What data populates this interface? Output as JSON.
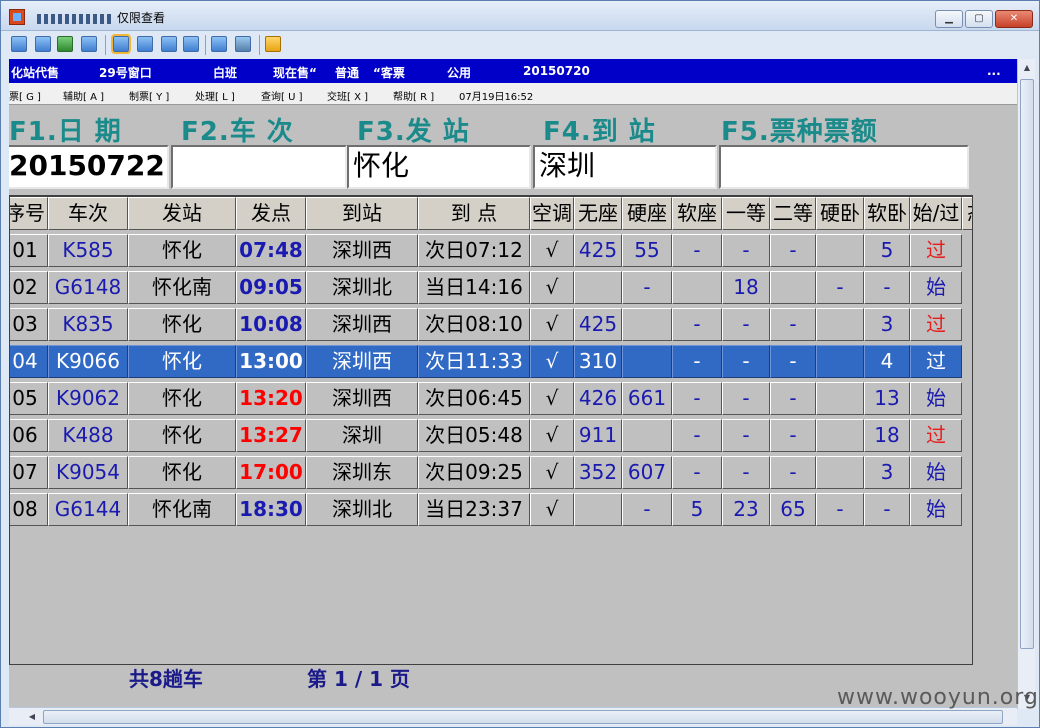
{
  "window": {
    "title": "仅限查看"
  },
  "status": {
    "station": "化站代售",
    "window_no": "29号窗口",
    "shift": "白班",
    "selling_label": "现在售“",
    "selling_type": "普通",
    "ticket_kind": "“客票",
    "purpose": "公用",
    "date": "20150720",
    "more": "..."
  },
  "menu": [
    "票[ G ]",
    "辅助[ A ]",
    "制票[ Y ]",
    "处理[ L ]",
    "查询[ U ]",
    "交班[ X ]",
    "帮助[ R ]",
    "07月19日16:52"
  ],
  "form": {
    "f1_label": "F1.日 期",
    "f2_label": "F2.车 次",
    "f3_label": "F3.发 站",
    "f4_label": "F4.到 站",
    "f5_label": "F5.票种票额",
    "f1_value": "20150722",
    "f2_value": "",
    "f3_value": "怀化",
    "f4_value": "深圳",
    "f5_value": ""
  },
  "table": {
    "headers": [
      "序号",
      "车次",
      "发站",
      "发点",
      "到站",
      "到 点",
      "空调",
      "无座",
      "硬座",
      "软座",
      "一等",
      "二等",
      "硬卧",
      "软卧",
      "始/过",
      "态"
    ],
    "rows": [
      {
        "no": "01",
        "train": "K585",
        "from": "怀化",
        "dep": "07:48",
        "dep_red": false,
        "to": "深圳西",
        "arr": "次日07:12",
        "ac": "√",
        "wz": "425",
        "yz": "55",
        "rz": "-",
        "yd": "-",
        "ed": "-",
        "yw": "",
        "rw": "5",
        "sg": "过"
      },
      {
        "no": "02",
        "train": "G6148",
        "from": "怀化南",
        "dep": "09:05",
        "dep_red": false,
        "to": "深圳北",
        "arr": "当日14:16",
        "ac": "√",
        "wz": "",
        "yz": "-",
        "rz": "",
        "yd": "18",
        "ed": "",
        "yw": "-",
        "rw": "-",
        "sg": "始"
      },
      {
        "no": "03",
        "train": "K835",
        "from": "怀化",
        "dep": "10:08",
        "dep_red": false,
        "to": "深圳西",
        "arr": "次日08:10",
        "ac": "√",
        "wz": "425",
        "yz": "",
        "rz": "-",
        "yd": "-",
        "ed": "-",
        "yw": "",
        "rw": "3",
        "sg": "过"
      },
      {
        "no": "04",
        "train": "K9066",
        "from": "怀化",
        "dep": "13:00",
        "dep_red": false,
        "to": "深圳西",
        "arr": "次日11:33",
        "ac": "√",
        "wz": "310",
        "yz": "",
        "rz": "-",
        "yd": "-",
        "ed": "-",
        "yw": "",
        "rw": "4",
        "sg": "过",
        "selected": true
      },
      {
        "no": "05",
        "train": "K9062",
        "from": "怀化",
        "dep": "13:20",
        "dep_red": true,
        "to": "深圳西",
        "arr": "次日06:45",
        "ac": "√",
        "wz": "426",
        "yz": "661",
        "rz": "-",
        "yd": "-",
        "ed": "-",
        "yw": "",
        "rw": "13",
        "sg": "始"
      },
      {
        "no": "06",
        "train": "K488",
        "from": "怀化",
        "dep": "13:27",
        "dep_red": true,
        "to": "深圳",
        "arr": "次日05:48",
        "ac": "√",
        "wz": "911",
        "yz": "",
        "rz": "-",
        "yd": "-",
        "ed": "-",
        "yw": "",
        "rw": "18",
        "sg": "过"
      },
      {
        "no": "07",
        "train": "K9054",
        "from": "怀化",
        "dep": "17:00",
        "dep_red": true,
        "to": "深圳东",
        "arr": "次日09:25",
        "ac": "√",
        "wz": "352",
        "yz": "607",
        "rz": "-",
        "yd": "-",
        "ed": "-",
        "yw": "",
        "rw": "3",
        "sg": "始"
      },
      {
        "no": "08",
        "train": "G6144",
        "from": "怀化南",
        "dep": "18:30",
        "dep_red": false,
        "to": "深圳北",
        "arr": "当日23:37",
        "ac": "√",
        "wz": "",
        "yz": "-",
        "rz": "5",
        "yd": "23",
        "ed": "65",
        "yw": "-",
        "rw": "-",
        "sg": "始"
      }
    ]
  },
  "footer": {
    "total": "共8趟车",
    "page": "第 1 / 1 页"
  },
  "watermark": "www.wooyun.org",
  "colors": {
    "status_bar": "#0000c8",
    "label_teal": "#1a8a8a",
    "selected_row": "#316ac5",
    "red_time": "#ff0000"
  }
}
